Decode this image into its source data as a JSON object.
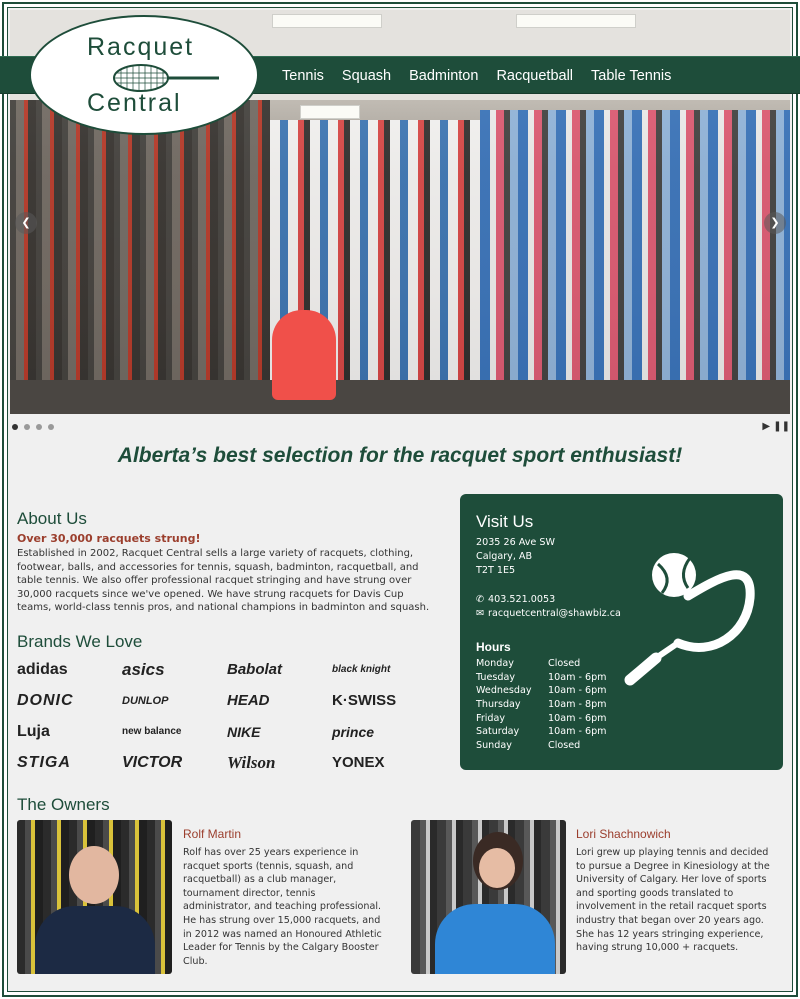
{
  "logo": {
    "line1": "Racquet",
    "line2": "Central"
  },
  "nav": {
    "items": [
      "Tennis",
      "Squash",
      "Badminton",
      "Racquetball",
      "Table Tennis"
    ]
  },
  "slider": {
    "dots": 4,
    "active": 0,
    "prev_icon": "chevron-left-icon",
    "next_icon": "chevron-right-icon"
  },
  "tagline": "Alberta’s best selection for the racquet sport enthusiast!",
  "about": {
    "title": "About Us",
    "subtitle": "Over 30,000 racquets strung!",
    "text": "Established in 2002, Racquet Central sells a large variety of racquets, clothing, footwear, balls, and accessories for tennis, squash, badminton, racquetball, and table tennis. We also offer professional racquet stringing and have strung over 30,000 racquets since we've opened. We have strung racquets for Davis Cup teams, world-class tennis pros, and national champions in badminton and squash."
  },
  "brands": {
    "title": "Brands We Love",
    "items": [
      "adidas",
      "asics",
      "Babolat",
      "black knight",
      "DONIC",
      "DUNLOP",
      "HEAD",
      "K·SWISS",
      "Luja",
      "new balance",
      "NIKE",
      "prince",
      "STIGA",
      "VICTOR",
      "Wilson",
      "YONEX"
    ]
  },
  "owners": {
    "title": "The Owners",
    "people": [
      {
        "name": "Rolf Martin",
        "text": "Rolf has over 25 years experience in racquet sports (tennis, squash, and racquetball) as a club manager, tournament director, tennis administrator, and teaching professional. He has strung over 15,000 racquets, and in 2012 was named an Honoured Athletic Leader for Tennis by the Calgary Booster Club."
      },
      {
        "name": "Lori Shachnowich",
        "text": "Lori grew up playing tennis and decided to pursue a Degree in Kinesiology at the University of Calgary. Her love of sports and sporting goods translated to involvement in the retail racquet sports industry that began over 20 years ago. She has 12 years stringing experience, having strung 10,000 + racquets."
      }
    ]
  },
  "visit": {
    "title": "Visit Us",
    "address": [
      "2035 26 Ave SW",
      "Calgary, AB",
      "T2T 1E5"
    ],
    "phone": "403.521.0053",
    "email": "racquetcentral@shawbiz.ca",
    "hours_title": "Hours",
    "hours": [
      {
        "day": "Monday",
        "time": "Closed"
      },
      {
        "day": "Tuesday",
        "time": "10am - 6pm"
      },
      {
        "day": "Wednesday",
        "time": "10am - 6pm"
      },
      {
        "day": "Thursday",
        "time": "10am - 8pm"
      },
      {
        "day": "Friday",
        "time": "10am - 6pm"
      },
      {
        "day": "Saturday",
        "time": "10am - 6pm"
      },
      {
        "day": "Sunday",
        "time": "Closed"
      }
    ]
  },
  "colors": {
    "brand_green": "#1e4d3a",
    "accent_red": "#9b3e2d",
    "background": "#f0f0f0"
  }
}
